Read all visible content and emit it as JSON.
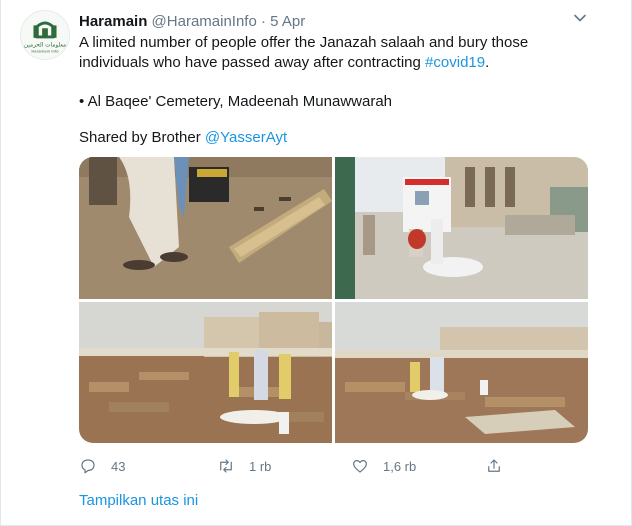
{
  "tweet": {
    "author_name": "Haramain",
    "author_handle": "@HaramainInfo",
    "separator": "·",
    "date": "5 Apr",
    "line1": "A limited number of people offer the Janazah salaah and bury those",
    "line2_prefix": "individuals who have passed away after contracting ",
    "hashtag": "#covid19",
    "line2_suffix": ".",
    "location_line": "• Al Baqee' Cemetery, Madeenah Munawwarah",
    "shared_prefix": "Shared by Brother ",
    "shared_handle": "@YasserAyt"
  },
  "avatar": {
    "logo_text_ar": "معلومات الحرمين",
    "logo_text_en": "Haramain Info",
    "logo_color": "#2f6b3b"
  },
  "actions": {
    "reply_icon": "reply-icon",
    "reply_count": "43",
    "retweet_icon": "retweet-icon",
    "retweet_count": "1 rb",
    "like_icon": "heart-icon",
    "like_count": "1,6 rb",
    "share_icon": "share-icon"
  },
  "thread_link": "Tampilkan utas ini",
  "colors": {
    "link": "#1b95e0",
    "muted": "#657786",
    "text": "#14171a",
    "border": "#e1e8ed"
  }
}
